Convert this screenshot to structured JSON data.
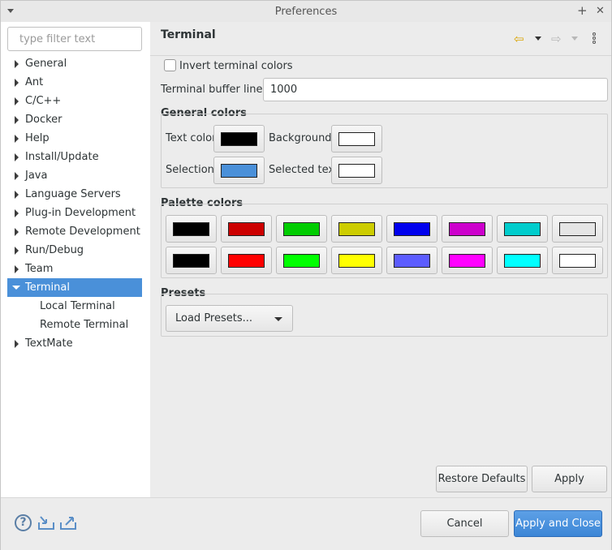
{
  "window": {
    "title": "Preferences",
    "maximize_glyph": "+",
    "close_glyph": "✕"
  },
  "sidebar": {
    "filter_placeholder": "type filter text",
    "items": [
      {
        "label": "General",
        "expanded": false
      },
      {
        "label": "Ant",
        "expanded": false
      },
      {
        "label": "C/C++",
        "expanded": false
      },
      {
        "label": "Docker",
        "expanded": false
      },
      {
        "label": "Help",
        "expanded": false
      },
      {
        "label": "Install/Update",
        "expanded": false
      },
      {
        "label": "Java",
        "expanded": false
      },
      {
        "label": "Language Servers",
        "expanded": false
      },
      {
        "label": "Plug-in Development",
        "expanded": false
      },
      {
        "label": "Remote Development",
        "expanded": false
      },
      {
        "label": "Run/Debug",
        "expanded": false
      },
      {
        "label": "Team",
        "expanded": false
      },
      {
        "label": "Terminal",
        "expanded": true,
        "selected": true
      },
      {
        "label": "Local Terminal",
        "child": true
      },
      {
        "label": "Remote Terminal",
        "child": true
      },
      {
        "label": "TextMate",
        "expanded": false
      }
    ]
  },
  "page": {
    "title": "Terminal",
    "back_glyph": "⇦",
    "forward_glyph": "⇨",
    "invert_label": "Invert terminal colors",
    "invert_checked": false,
    "buffer_label": "Terminal buffer lines:",
    "buffer_value": "1000",
    "general_colors": {
      "heading": "General colors",
      "text_color_label": "Text color",
      "background_label": "Background",
      "selection_label": "Selection",
      "selected_text_label": "Selected text",
      "text_color": "#000000",
      "background": "#ffffff",
      "selection": "#4a90d9",
      "selected_text": "#ffffff"
    },
    "palette": {
      "heading": "Palette colors",
      "row1": [
        "#000000",
        "#cd0000",
        "#00cd00",
        "#cdcd00",
        "#0000ee",
        "#cd00cd",
        "#00cdcd",
        "#e5e5e5"
      ],
      "row2": [
        "#000000",
        "#ff0000",
        "#00ff00",
        "#ffff00",
        "#5c5cff",
        "#ff00ff",
        "#00ffff",
        "#ffffff"
      ]
    },
    "presets": {
      "heading": "Presets",
      "load_label": "Load Presets..."
    },
    "restore_defaults_label": "Restore Defaults",
    "apply_label": "Apply"
  },
  "footer": {
    "help_glyph": "?",
    "cancel_label": "Cancel",
    "apply_close_label": "Apply and Close"
  }
}
